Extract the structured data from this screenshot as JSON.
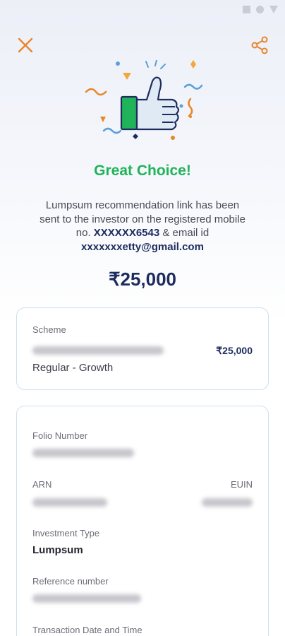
{
  "header": {
    "close_icon": "close-icon",
    "share_icon": "share-icon",
    "accent_color": "#e8862a"
  },
  "hero": {
    "illustration": "thumbs-up-celebration-icon"
  },
  "title": "Great Choice!",
  "message": {
    "part1": "Lumpsum recommendation link has been sent to the investor on the registered mobile no.",
    "mobile": "XXXXXX6543",
    "part2": "& email id",
    "email": "xxxxxxxetty@gmail.com"
  },
  "amount": "₹25,000",
  "scheme_card": {
    "label": "Scheme",
    "amount": "₹25,000",
    "plan": "Regular - Growth"
  },
  "details_card": {
    "folio_label": "Folio Number",
    "arn_label": "ARN",
    "euin_label": "EUIN",
    "investment_type_label": "Investment Type",
    "investment_type_value": "Lumpsum",
    "reference_label": "Reference number",
    "transaction_label": "Transaction  Date and Time"
  },
  "colors": {
    "success": "#21b35a",
    "navy": "#1d2c5e",
    "card_border": "#cfe0ee"
  }
}
